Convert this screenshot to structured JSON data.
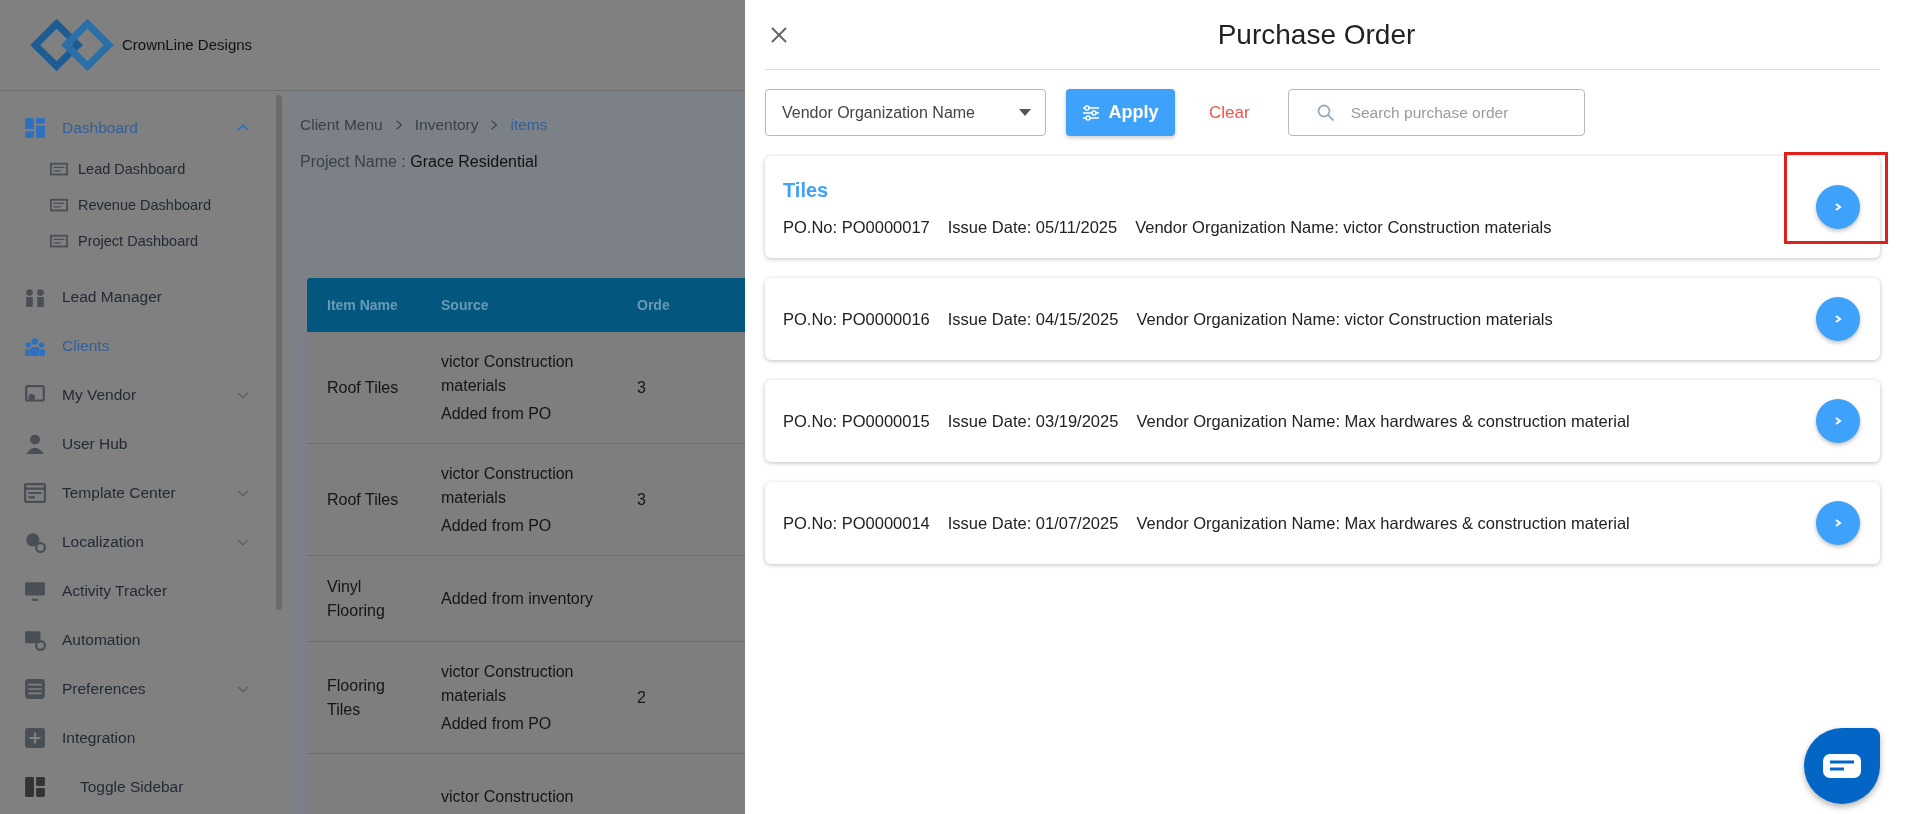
{
  "brand": {
    "name": "CrownLine Designs"
  },
  "sidebar": {
    "items": [
      {
        "label": "Dashboard",
        "selected": true,
        "expanded": true,
        "children": [
          {
            "label": "Lead Dashboard"
          },
          {
            "label": "Revenue Dashboard"
          },
          {
            "label": "Project Dashboard"
          }
        ]
      },
      {
        "label": "Lead Manager",
        "selected": false
      },
      {
        "label": "Clients",
        "selected": true
      },
      {
        "label": "My Vendor",
        "selected": false,
        "expanded": false
      },
      {
        "label": "User Hub",
        "selected": false
      },
      {
        "label": "Template Center",
        "selected": false,
        "expanded": false
      },
      {
        "label": "Localization",
        "selected": false,
        "expanded": false
      },
      {
        "label": "Activity Tracker",
        "selected": false
      },
      {
        "label": "Automation",
        "selected": false
      },
      {
        "label": "Preferences",
        "selected": false,
        "expanded": false
      },
      {
        "label": "Integration",
        "selected": false
      }
    ],
    "toggle": "Toggle Sidebar"
  },
  "breadcrumb": [
    {
      "label": "Client Menu",
      "selected": false
    },
    {
      "label": "Inventory",
      "selected": false
    },
    {
      "label": "items",
      "selected": true
    }
  ],
  "project": {
    "label": "Project Name :",
    "value": "Grace Residential"
  },
  "table": {
    "columns": [
      "Item Name",
      "Source",
      "Orde"
    ],
    "rows": [
      {
        "item": "Roof Tiles",
        "source": [
          "victor Construction materials",
          "Added from PO"
        ],
        "column_3": "3"
      },
      {
        "item": "Roof Tiles",
        "source": [
          "victor Construction materials",
          "Added from PO"
        ],
        "column_3": "3"
      },
      {
        "item": "Vinyl Flooring",
        "source": [
          "Added from inventory"
        ]
      },
      {
        "item": "Flooring Tiles",
        "source": [
          "victor Construction materials",
          "Added from PO"
        ],
        "column_3": "2"
      },
      {
        "source": [
          "victor Construction"
        ]
      }
    ]
  },
  "drawer": {
    "title": "Purchase Order",
    "filter": {
      "select": "Vendor Organization Name",
      "apply": "Apply",
      "clear": "Clear",
      "search_placeholder": "Search purchase order"
    },
    "orders": [
      {
        "title": "Tiles",
        "po": "PO.No: PO0000017",
        "date": "Issue Date: 05/11/2025",
        "vendor": "Vendor Organization Name: victor Construction materials",
        "highlighted": true
      },
      {
        "po": "PO.No: PO0000016",
        "date": "Issue Date: 04/15/2025",
        "vendor": "Vendor Organization Name: victor Construction materials",
        "highlighted": false
      },
      {
        "po": "PO.No: PO0000015",
        "date": "Issue Date: 03/19/2025",
        "vendor": "Vendor Organization Name: Max hardwares & construction material",
        "highlighted": false
      },
      {
        "po": "PO.No: PO0000014",
        "date": "Issue Date: 01/07/2025",
        "vendor": "Vendor Organization Name: Max hardwares & construction material",
        "highlighted": false
      }
    ]
  }
}
